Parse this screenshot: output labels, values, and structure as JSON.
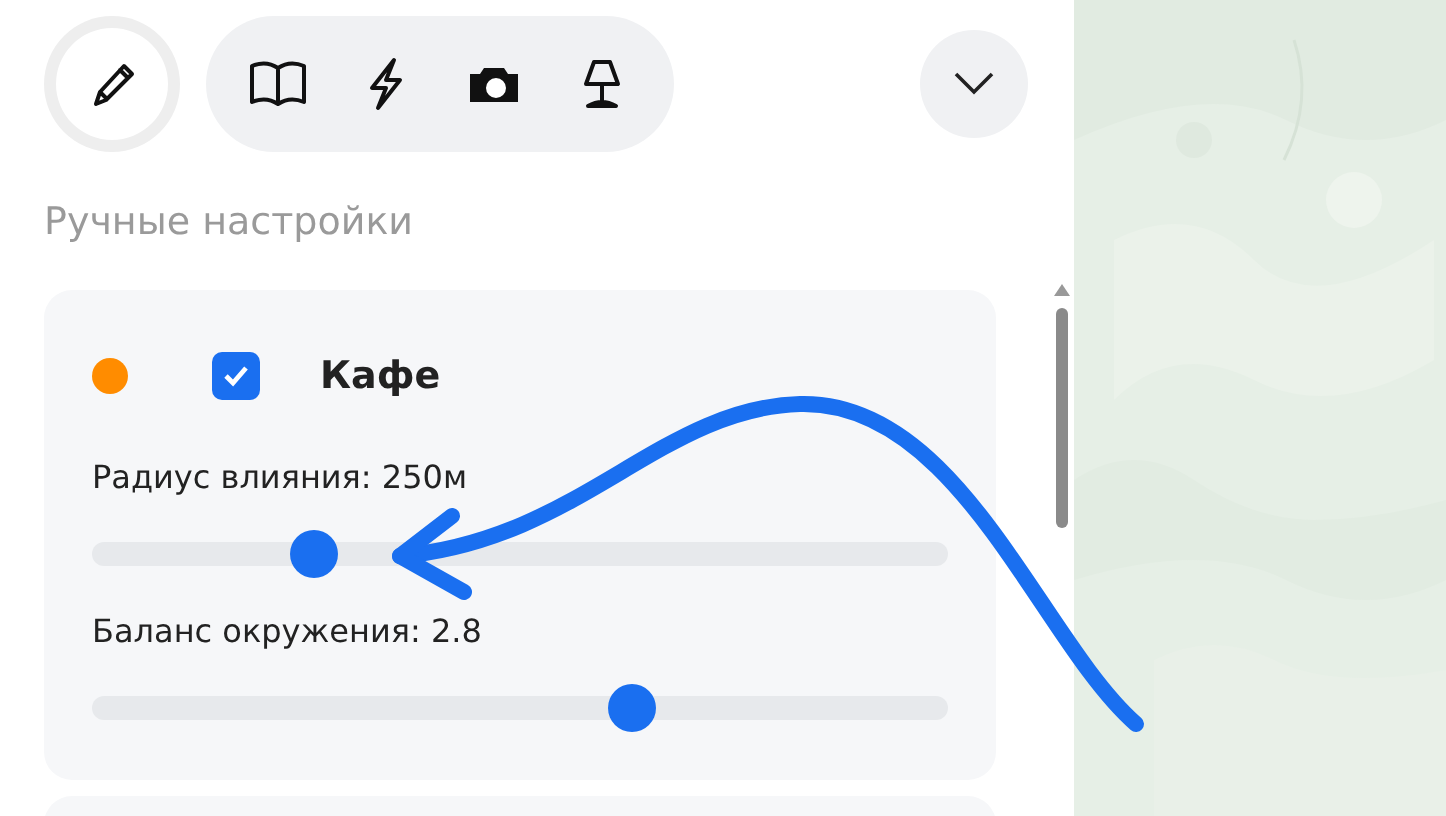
{
  "toolbar": {
    "tools": [
      {
        "kind": "pencil",
        "selected": true
      },
      {
        "kind": "book",
        "selected": false
      },
      {
        "kind": "bolt",
        "selected": false
      },
      {
        "kind": "camera",
        "selected": false
      },
      {
        "kind": "lamp",
        "selected": false
      }
    ]
  },
  "section_title": "Ручные настройки",
  "layers": [
    {
      "name": "Кафе",
      "color": "#ff8c00",
      "checked": true,
      "sliders": [
        {
          "label": "Радиус влияния: 250м",
          "level": 0.26
        },
        {
          "label": "Баланс окружения: 2.8",
          "level": 0.63
        }
      ]
    }
  ]
}
